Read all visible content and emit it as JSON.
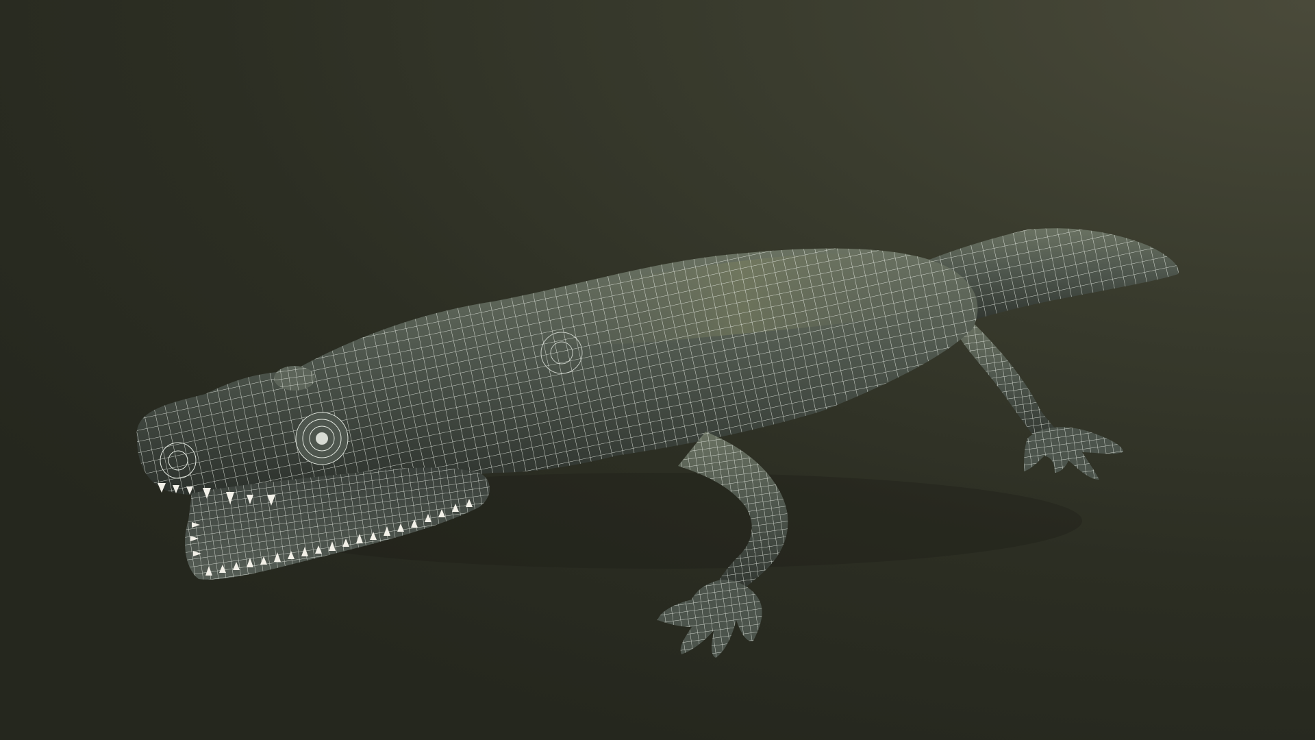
{
  "scene": {
    "subject": "amphibian-wireframe-render",
    "background_color_top_right": "#4a4a3a",
    "background_color_bottom_left": "#25271e",
    "skin_color": "#4a514a",
    "skin_highlight": "#6b735f",
    "wire_color": "#e8ece6",
    "teeth_color": "#f2f0e8"
  }
}
